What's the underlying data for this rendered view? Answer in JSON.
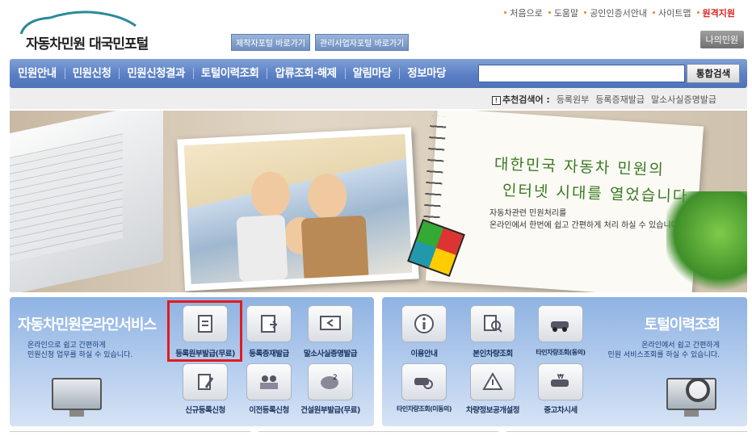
{
  "top_links": [
    "처음으로",
    "도움말",
    "공인인증서안내",
    "사이트맵",
    "원격지원"
  ],
  "logo": {
    "text": "자동차민원 대국민포털"
  },
  "portal_buttons": [
    "제작자포털 바로가기",
    "관리사업자포털 바로가기"
  ],
  "my_button": "나의민원",
  "nav": [
    "민원안내",
    "민원신청",
    "민원신청결과",
    "토털이력조회",
    "압류조회·해제",
    "알림마당",
    "정보마당"
  ],
  "search": {
    "placeholder": "",
    "button": "통합검색"
  },
  "recommended": {
    "label": "추천검색어 :",
    "terms": [
      "등록원부",
      "등록증재발급",
      "말소사실증명발급"
    ]
  },
  "banner": {
    "headline1": "대한민국 자동차 민원의",
    "headline2": "인터넷 시대를 열었습니다.",
    "desc1": "자동차관련 민원처리를",
    "desc2": "온라인에서 한번에 쉽고 간편하게 처리 하실 수 있습니다."
  },
  "services_left": {
    "title": "자동차민원온라인서비스",
    "desc1": "온라인으로 쉽고 간편하게",
    "desc2": "민원신청 업무를 하실 수 있습니다.",
    "tiles": [
      {
        "label": "등록원부발급(무료)",
        "icon": "document-icon"
      },
      {
        "label": "등록증재발급",
        "icon": "reissue-icon"
      },
      {
        "label": "말소사실증명발급",
        "icon": "certificate-icon"
      },
      {
        "label": "신규등록신청",
        "icon": "new-registration-icon"
      },
      {
        "label": "이전등록신청",
        "icon": "transfer-icon"
      },
      {
        "label": "건설원부발급(무료)",
        "icon": "construction-icon"
      }
    ]
  },
  "services_right": {
    "title": "토털이력조회",
    "desc1": "온라인에서 쉽고 간편하게",
    "desc2": "민원 서비스조회를 하실 수 있습니다.",
    "tiles": [
      {
        "label": "이용안내",
        "icon": "info-icon"
      },
      {
        "label": "본인차량조회",
        "icon": "my-car-search-icon"
      },
      {
        "label": "타인차량조회(동의)",
        "icon": "car-consent-icon"
      },
      {
        "label": "타인차량조회(미동의)",
        "icon": "car-no-consent-icon"
      },
      {
        "label": "차량정보공개설정",
        "icon": "warning-icon"
      },
      {
        "label": "중고차시세",
        "icon": "used-car-price-icon"
      }
    ]
  },
  "colors": {
    "nav": "#5a7fc4",
    "highlight": "#e31b1b",
    "headline": "#3a7a22"
  }
}
